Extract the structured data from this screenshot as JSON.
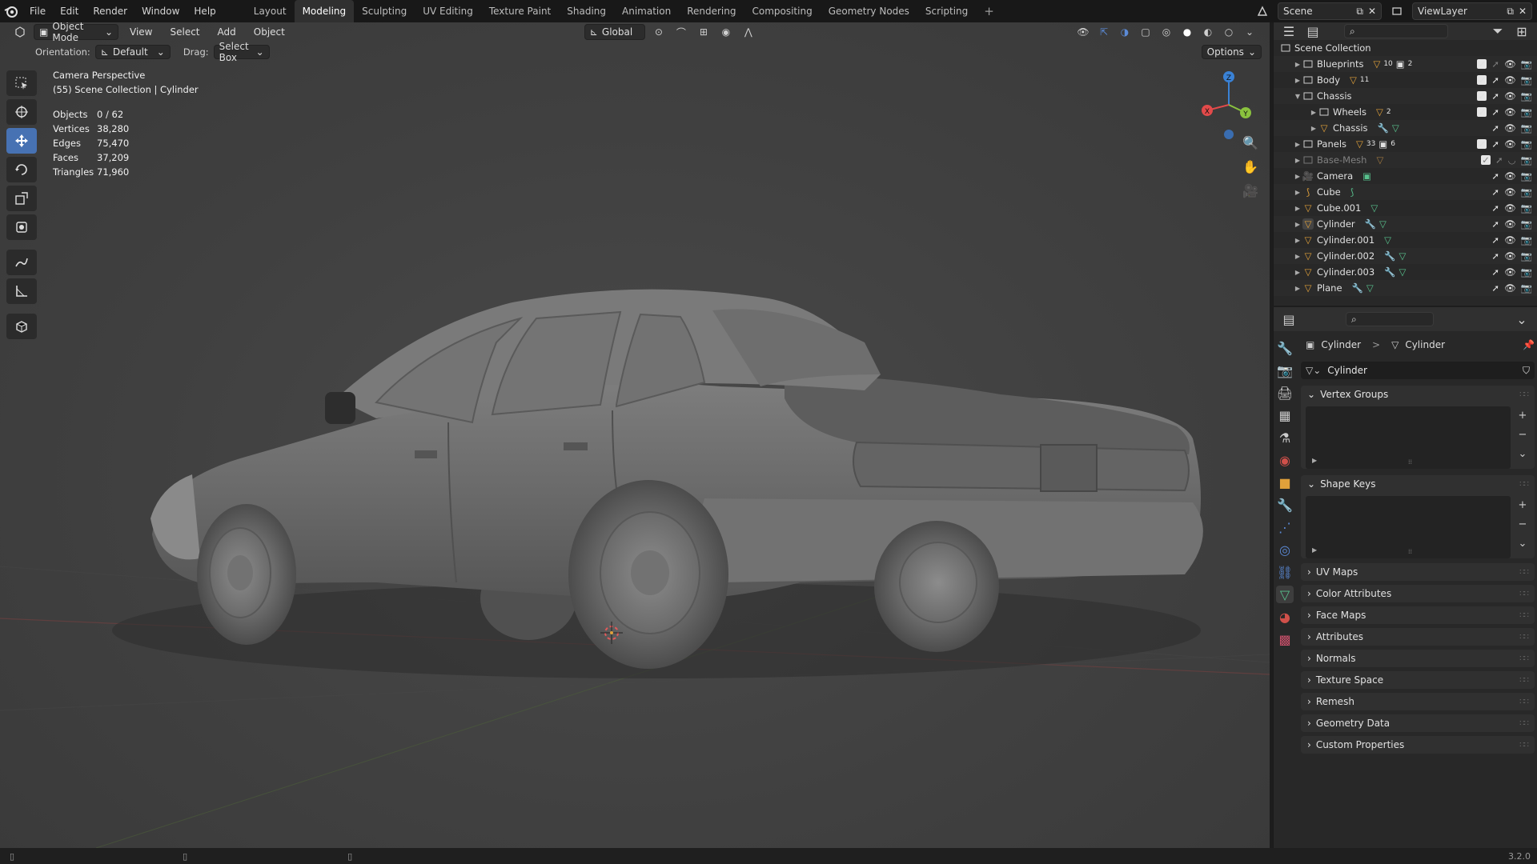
{
  "topbar": {
    "menu": [
      "File",
      "Edit",
      "Render",
      "Window",
      "Help"
    ],
    "workspaces": [
      "Layout",
      "Modeling",
      "Sculpting",
      "UV Editing",
      "Texture Paint",
      "Shading",
      "Animation",
      "Rendering",
      "Compositing",
      "Geometry Nodes",
      "Scripting"
    ],
    "active_workspace": "Modeling",
    "add_tab": "+",
    "scene": "Scene",
    "view_layer": "ViewLayer"
  },
  "viewport": {
    "mode": "Object Mode",
    "menus": [
      "View",
      "Select",
      "Add",
      "Object"
    ],
    "transform_orientation": "Global",
    "orientation_label": "Orientation:",
    "orientation_value": "Default",
    "drag_label": "Drag:",
    "drag_value": "Select Box",
    "options": "Options",
    "camera_line": "Camera Perspective",
    "collection_line": "(55) Scene Collection | Cylinder",
    "stats": [
      {
        "label": "Objects",
        "value": "0 / 62"
      },
      {
        "label": "Vertices",
        "value": "38,280"
      },
      {
        "label": "Edges",
        "value": "75,470"
      },
      {
        "label": "Faces",
        "value": "37,209"
      },
      {
        "label": "Triangles",
        "value": "71,960"
      }
    ],
    "gizmo": {
      "x": "X",
      "y": "Y",
      "z": "Z"
    }
  },
  "outliner": {
    "root": "Scene Collection",
    "items": [
      {
        "name": "Blueprints",
        "badge1": "10",
        "badge2": "2",
        "type": "collection"
      },
      {
        "name": "Body",
        "badge1": "11",
        "type": "collection"
      },
      {
        "name": "Chassis",
        "type": "collection"
      },
      {
        "name": "Wheels",
        "badge1": "2",
        "type": "collection"
      },
      {
        "name": "Chassis",
        "type": "mesh"
      },
      {
        "name": "Panels",
        "badge1": "33",
        "badge2": "6",
        "type": "collection"
      },
      {
        "name": "Base-Mesh",
        "type": "mesh"
      },
      {
        "name": "Camera",
        "type": "camera"
      },
      {
        "name": "Cube",
        "type": "curve"
      },
      {
        "name": "Cube.001",
        "type": "mesh"
      },
      {
        "name": "Cylinder",
        "type": "mesh"
      },
      {
        "name": "Cylinder.001",
        "type": "mesh"
      },
      {
        "name": "Cylinder.002",
        "type": "mesh"
      },
      {
        "name": "Cylinder.003",
        "type": "mesh"
      },
      {
        "name": "Plane",
        "type": "mesh"
      }
    ]
  },
  "properties": {
    "crumb_object": "Cylinder",
    "crumb_sep": ">",
    "crumb_data": "Cylinder",
    "mesh_name": "Cylinder",
    "vertex_groups": "Vertex Groups",
    "shape_keys": "Shape Keys",
    "collapsed_panels": [
      "UV Maps",
      "Color Attributes",
      "Face Maps",
      "Attributes",
      "Normals",
      "Texture Space",
      "Remesh",
      "Geometry Data",
      "Custom Properties"
    ],
    "add_symbol": "+",
    "remove_symbol": "−"
  },
  "statusbar": {
    "version": "3.2.0"
  },
  "colors": {
    "accent": "#4772b3",
    "x_axis": "#e24a4a",
    "y_axis": "#8ac23e",
    "z_axis": "#3a82d6",
    "mesh_icon": "#e0a03a",
    "data_icon": "#58c18d"
  }
}
